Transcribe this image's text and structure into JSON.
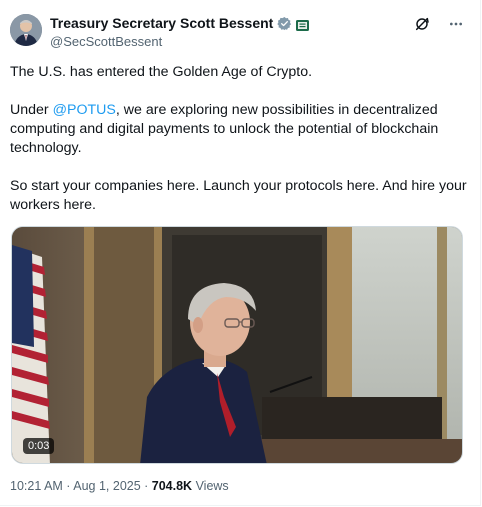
{
  "author": {
    "name": "Treasury Secretary Scott Bessent",
    "handle": "@SecScottBessent"
  },
  "post": {
    "line1": "The U.S. has entered the Golden Age of Crypto.",
    "p2_pre": "Under ",
    "p2_mention": "@POTUS",
    "p2_post": ", we are exploring new possibilities in decentralized computing and digital payments to unlock the potential of blockchain technology.",
    "p3": "So start your companies here. Launch your protocols here. And hire your workers here."
  },
  "media": {
    "duration": "0:03"
  },
  "meta": {
    "time": "10:21 AM",
    "separator": " · ",
    "date": "Aug 1, 2025",
    "views_count": "704.8K",
    "views_label": " Views"
  },
  "icons": {
    "verified": "verified-badge-icon",
    "affiliation": "treasury-seal-icon",
    "grok": "grok-icon",
    "more": "more-icon"
  },
  "colors": {
    "link": "#1d9bf0",
    "secondary_text": "#536471",
    "verified_gray": "#829aab"
  }
}
